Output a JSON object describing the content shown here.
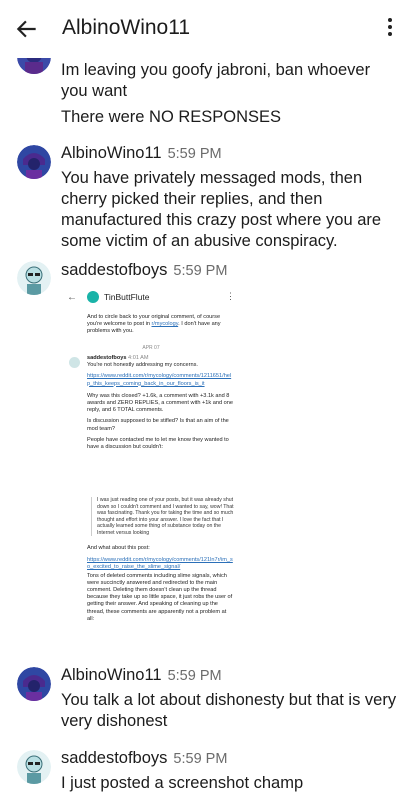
{
  "header": {
    "title": "AlbinoWino11",
    "back_icon": "arrow-left-icon",
    "menu_icon": "vertical-dots-icon"
  },
  "messages": [
    {
      "author": "",
      "time": "",
      "lines": [
        "Im leaving you goofy jabroni, ban whoever you want",
        "There were NO RESPONSES"
      ]
    },
    {
      "author": "AlbinoWino11",
      "time": "5:59 PM",
      "text": "You have privately messaged mods, then cherry picked their replies, and then manufactured this crazy post where you are some victim of an abusive conspiracy."
    },
    {
      "author": "saddestofboys",
      "time": "5:59 PM",
      "attachment": "screenshot"
    },
    {
      "author": "AlbinoWino11",
      "time": "5:59 PM",
      "text": "You talk a lot about dishonesty but that is very very dishonest"
    },
    {
      "author": "saddestofboys",
      "time": "5:59 PM",
      "text": "I just posted a screenshot champ"
    }
  ],
  "screenshot": {
    "title": "TinButtFlute",
    "intro": "And to circle back to your original comment, of course you're welcome to post in",
    "intro_link": "r/mycology",
    "intro_end": ". I don't have any problems with you.",
    "date": "APR 07",
    "author": "saddestofboys",
    "time": "4:01 AM",
    "p1": "You're not honestly addressing my concerns.",
    "link1": "https://www.reddit.com/r/mycology/comments/1211651/help_this_keeps_coming_back_in_our_floors_is_it",
    "p2": "Why was this closed? +1.6k, a comment with +3.1k and 8 awards and ZERO REPLIES, a comment with +1k and one reply, and 6 TOTAL comments.",
    "p3": "Is discussion supposed to be stifled? Is that an aim of the mod team?",
    "p4": "People have contacted me to let me know they wanted to have a discussion but couldn't:",
    "quote": "I was just reading one of your posts, but it was already shut down so I couldn't comment and I wanted to say, wow! That was fascinating. Thank you for taking the time and so much thought and effort into your answer. I love the fact that I actually learned some thing of substance today on the Internet versus looking",
    "p5": "And what about this post:",
    "link2": "https://www.reddit.com/r/mycology/comments/121ln7r/im_so_excited_to_raise_the_slime_signal/",
    "p6": "Tons of deleted comments including slime signals, which were succinctly answered and redirected to the main comment. Deleting them doesn't clean up the thread because they take up so little space, it just robs the user of getting their answer. And speaking of cleaning up the thread, these comments are apparently not a problem at all:"
  }
}
